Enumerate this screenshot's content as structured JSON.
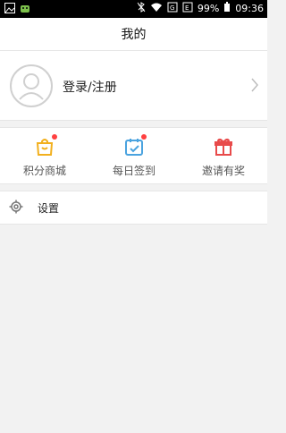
{
  "status_bar": {
    "battery_percent": "99%",
    "time": "09:36",
    "icons": [
      "image-icon",
      "android-icon",
      "bluetooth-off-icon",
      "wifi-icon",
      "signal-icon",
      "battery-icon"
    ]
  },
  "header": {
    "title": "我的"
  },
  "profile": {
    "login_label": "登录/注册",
    "avatar_icon": "user-avatar-icon",
    "chevron_icon": "chevron-right-icon"
  },
  "features": [
    {
      "label": "积分商城",
      "icon": "shopping-bag-icon",
      "color": "#f2b01e",
      "badge": true
    },
    {
      "label": "每日签到",
      "icon": "calendar-check-icon",
      "color": "#4aa3df",
      "badge": true
    },
    {
      "label": "邀请有奖",
      "icon": "gift-icon",
      "color": "#e84a4a",
      "badge": false
    }
  ],
  "settings": {
    "label": "设置",
    "icon": "gear-icon"
  },
  "colors": {
    "background": "#f2f2f2",
    "surface": "#ffffff",
    "badge": "#ff4040"
  }
}
